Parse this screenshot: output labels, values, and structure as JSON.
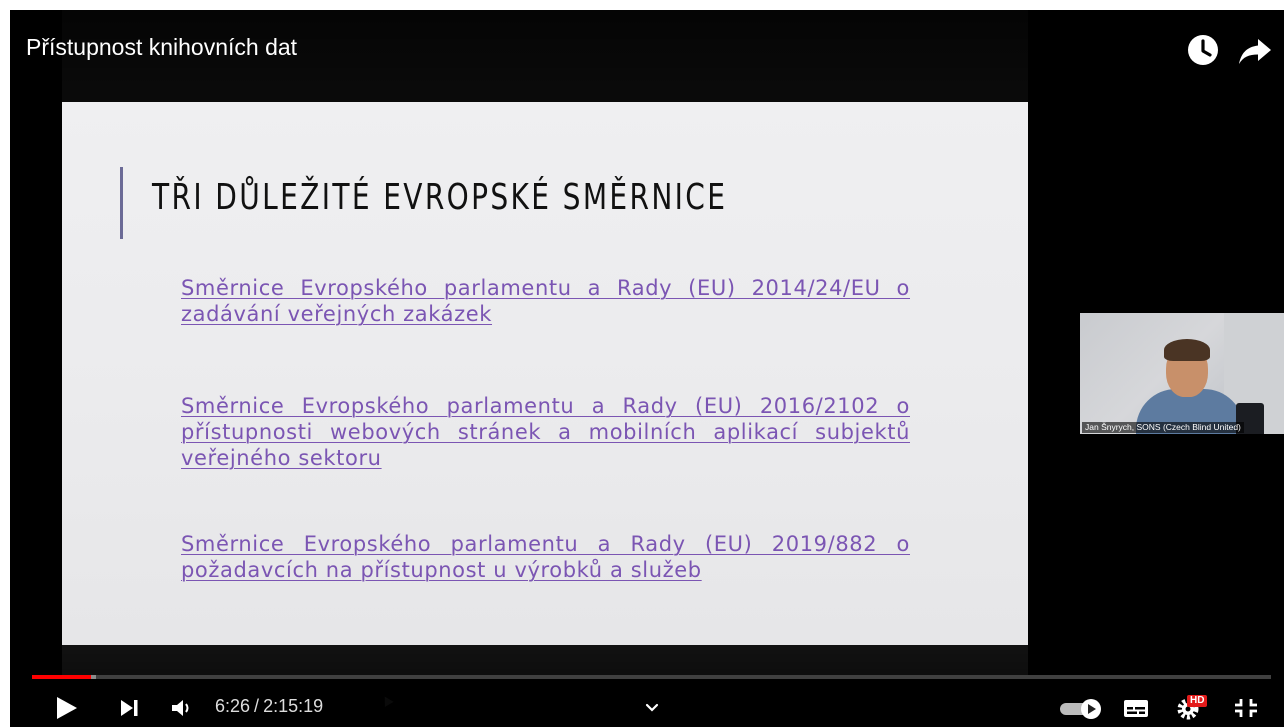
{
  "player": {
    "title": "Přístupnost knihovních dat",
    "slide": {
      "title": "TŘI DŮLEŽITÉ EVROPSKÉ SMĚRNICE",
      "links": [
        "Směrnice Evropského parlamentu a Rady (EU) 2014/24/EU o zadávání veřejných zakázek",
        "Směrnice Evropského parlamentu a Rady (EU) 2016/2102 o přístupnosti webových stránek a mobilních aplikací subjektů veřejného sektoru",
        "Směrnice Evropského parlamentu a Rady (EU) 2019/882 o požadavcích na přístupnost u výrobků a služeb"
      ]
    },
    "webcam_label": "Jan Šnyrych, SONS (Czech Blind United)",
    "controls": {
      "current_time": "6:26",
      "separator": "/",
      "duration": "2:15:19",
      "progress": {
        "played_fraction": 0.048,
        "loaded_fraction": 0.052
      },
      "hd_badge": "HD",
      "icons": {
        "play": "play-icon",
        "next": "next-icon",
        "volume": "volume-icon",
        "expand": "chevron-down-icon",
        "autoplay": "autoplay-toggle-icon",
        "subtitles": "subtitles-icon",
        "settings": "gear-icon",
        "fullscreen": "exit-fullscreen-icon",
        "watch_later": "clock-icon",
        "share": "share-icon"
      }
    },
    "colors": {
      "progress": "#ff0000",
      "link": "#7b55b3",
      "hd_badge": "#e31b1b",
      "slide_accent": "#6b6a96"
    }
  }
}
